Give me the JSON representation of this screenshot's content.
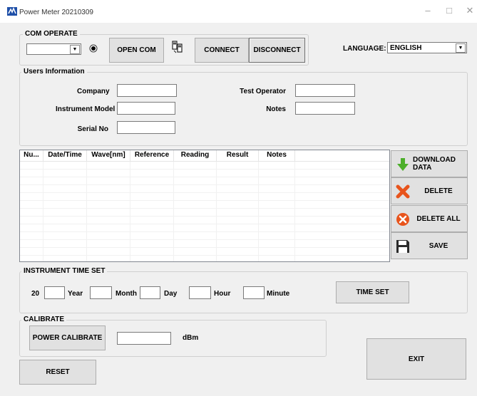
{
  "window": {
    "title": "Power Meter 20210309",
    "min_icon": "minimize-icon",
    "max_icon": "maximize-icon",
    "close_icon": "close-icon"
  },
  "com_operate": {
    "group_label": "COM OPERATE",
    "port_value": "",
    "open_label": "OPEN COM",
    "connect_label": "CONNECT",
    "disconnect_label": "DISCONNECT",
    "language_label": "LANGUAGE:",
    "language_value": "ENGLISH"
  },
  "users_info": {
    "group_label": "Users Information",
    "company_label": "Company",
    "company_value": "",
    "instrument_model_label": "Instrument Model",
    "instrument_model_value": "",
    "serial_no_label": "Serial No",
    "serial_no_value": "",
    "test_operator_label": "Test Operator",
    "test_operator_value": "",
    "notes_label": "Notes",
    "notes_value": ""
  },
  "table": {
    "columns": [
      "Nu...",
      "Date/Time",
      "Wave[nm]",
      "Reference",
      "Reading",
      "Result",
      "Notes"
    ],
    "rows": []
  },
  "actions": {
    "download_label": "DOWNLOAD DATA",
    "delete_label": "DELETE",
    "delete_all_label": "DELETE ALL",
    "save_label": "SAVE"
  },
  "time_set": {
    "group_label": "INSTRUMENT TIME SET",
    "century_prefix": "20",
    "year_label": "Year",
    "month_label": "Month",
    "day_label": "Day",
    "hour_label": "Hour",
    "minute_label": "Minute",
    "button_label": "TIME SET"
  },
  "calibrate": {
    "group_label": "CALIBRATE",
    "button_label": "POWER CALIBRATE",
    "value": "",
    "unit": "dBm"
  },
  "footer": {
    "reset_label": "RESET",
    "exit_label": "EXIT"
  },
  "colors": {
    "download_arrow": "#4caf2a",
    "delete_x": "#e8541c",
    "delete_all_circle": "#e8541c",
    "save_disk": "#2b2b2b"
  }
}
